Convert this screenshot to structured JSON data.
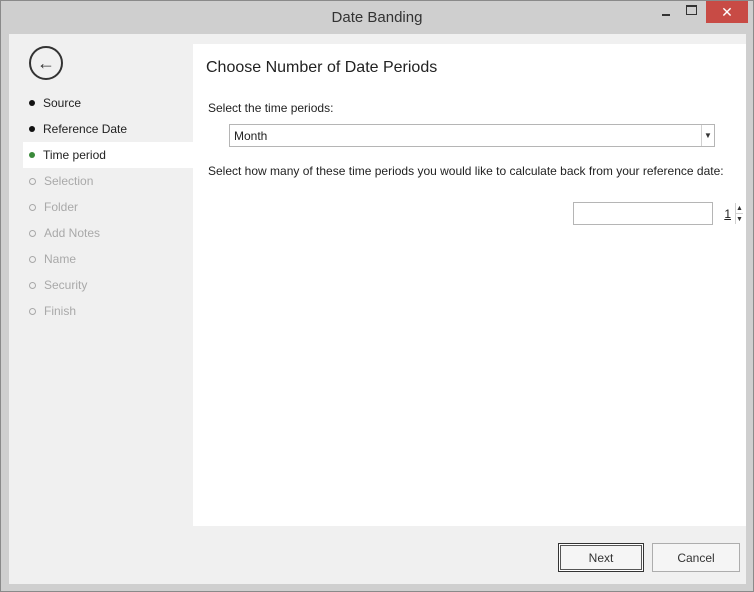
{
  "window": {
    "title": "Date Banding",
    "minimize_glyph": "—",
    "close_glyph": "✕"
  },
  "sidebar": {
    "back_icon": "back-arrow-icon",
    "back_glyph": "←",
    "items": [
      {
        "label": "Source",
        "state": "done"
      },
      {
        "label": "Reference Date",
        "state": "done"
      },
      {
        "label": "Time period",
        "state": "current"
      },
      {
        "label": "Selection",
        "state": "disabled"
      },
      {
        "label": "Folder",
        "state": "disabled"
      },
      {
        "label": "Add Notes",
        "state": "disabled"
      },
      {
        "label": "Name",
        "state": "disabled"
      },
      {
        "label": "Security",
        "state": "disabled"
      },
      {
        "label": "Finish",
        "state": "disabled"
      }
    ]
  },
  "main": {
    "heading": "Choose Number of Date Periods",
    "period_label": "Select the time periods:",
    "period_value": "Month",
    "count_label": "Select how many of these time periods you would like to calculate back from your reference date:",
    "count_value": "1"
  },
  "footer": {
    "next_label": "Next",
    "cancel_label": "Cancel"
  },
  "colors": {
    "current_step": "#3a8a3a",
    "close_button": "#c84b45",
    "chrome": "#cfcfcf"
  }
}
